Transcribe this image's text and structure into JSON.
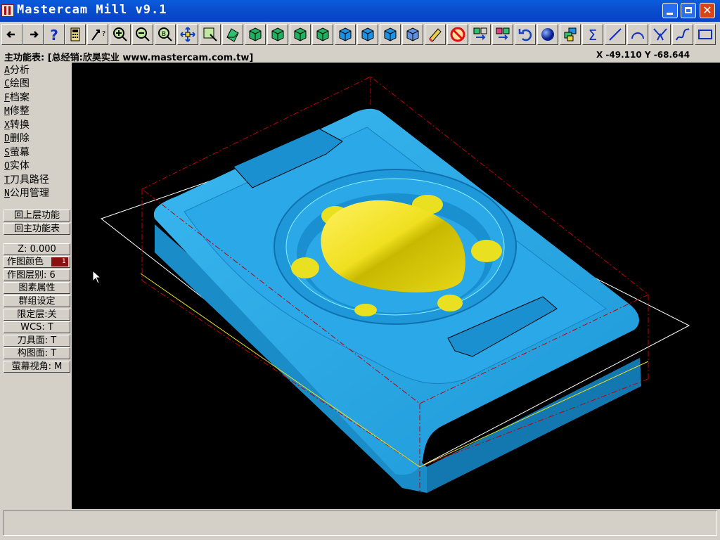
{
  "window": {
    "title": "Mastercam Mill v9.1"
  },
  "toolbar": {
    "icons": [
      "back-arrow-icon",
      "forward-arrow-icon",
      "help-icon",
      "calculator-icon",
      "pointer-query-icon",
      "zoom-in-icon",
      "zoom-out-icon",
      "zoom-previous-icon",
      "pan-icon",
      "zoom-window-icon",
      "dynamic-rotate-icon",
      "view-top-icon",
      "view-front-icon",
      "view-side-icon",
      "view-isometric-icon",
      "view-2-icon",
      "view-3-icon",
      "view-4-icon",
      "view-5-icon",
      "eraser-icon",
      "no-delete-icon",
      "translate-icon",
      "mirror-icon",
      "undo-icon",
      "shade-sphere-icon",
      "layers-icon",
      "sigma-icon",
      "line-icon",
      "arc-icon",
      "fillet-icon",
      "spline-icon",
      "rectangle-icon"
    ]
  },
  "statusline": {
    "menu_title": "主功能表: [总经销:欣昊实业 www.mastercam.com.tw]",
    "coords": "X -49.110  Y -68.644"
  },
  "menu": {
    "items": [
      {
        "key": "A",
        "label": "分析"
      },
      {
        "key": "C",
        "label": "绘图"
      },
      {
        "key": "F",
        "label": "档案"
      },
      {
        "key": "M",
        "label": "修整"
      },
      {
        "key": "X",
        "label": "转换"
      },
      {
        "key": "D",
        "label": "删除"
      },
      {
        "key": "S",
        "label": "萤幕"
      },
      {
        "key": "O",
        "label": "实体"
      },
      {
        "key": "T",
        "label": "刀具路径"
      },
      {
        "key": "N",
        "label": "公用管理"
      }
    ],
    "back_up": "回上层功能",
    "main_menu": "回主功能表"
  },
  "settings": {
    "z": "Z:  0.000",
    "color": "作图颜色",
    "color_value": "1",
    "level": "作图层别: 6",
    "attributes": "图素属性",
    "groups": "群组设定",
    "mask": "限定层:关",
    "wcs": "WCS: T",
    "tplane": "刀具面: T",
    "cplane": "构图面: T",
    "gview": "萤幕视角: M"
  },
  "colors": {
    "part": "#2aa8e8",
    "pocket_floor": "#e8e020",
    "titlebar": "#0a4fd0",
    "background": "#000000",
    "boundary_white": "#ffffff",
    "boundary_red": "#c00000",
    "boundary_yellow": "#e8e020"
  },
  "prompt": {
    "text": ""
  }
}
